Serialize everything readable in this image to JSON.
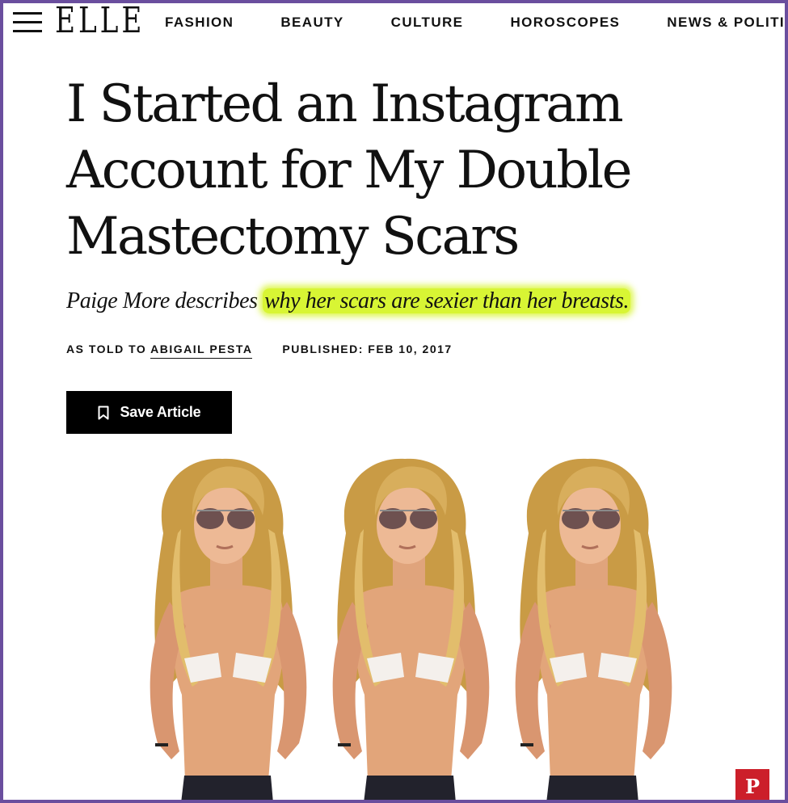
{
  "nav": {
    "logo": "ELLE",
    "items": [
      "FASHION",
      "BEAUTY",
      "CULTURE",
      "HOROSCOPES",
      "NEWS & POLITICS"
    ]
  },
  "article": {
    "headline": "I Started an Instagram Account for My Double Mastectomy Scars",
    "dek_prefix": "Paige More describes ",
    "dek_highlight": "why her scars are sexier than her breasts.",
    "byline_prefix": "AS TOLD TO",
    "author": "ABIGAIL PESTA",
    "published": "PUBLISHED: FEB 10, 2017",
    "save_label": "Save Article"
  },
  "icons": {
    "menu": "hamburger-menu-icon",
    "bookmark": "bookmark-icon",
    "pinterest": "pinterest-icon"
  },
  "colors": {
    "highlight": "#d8f534",
    "pinterest": "#cc1f2a",
    "frame": "#6a4e9e"
  }
}
